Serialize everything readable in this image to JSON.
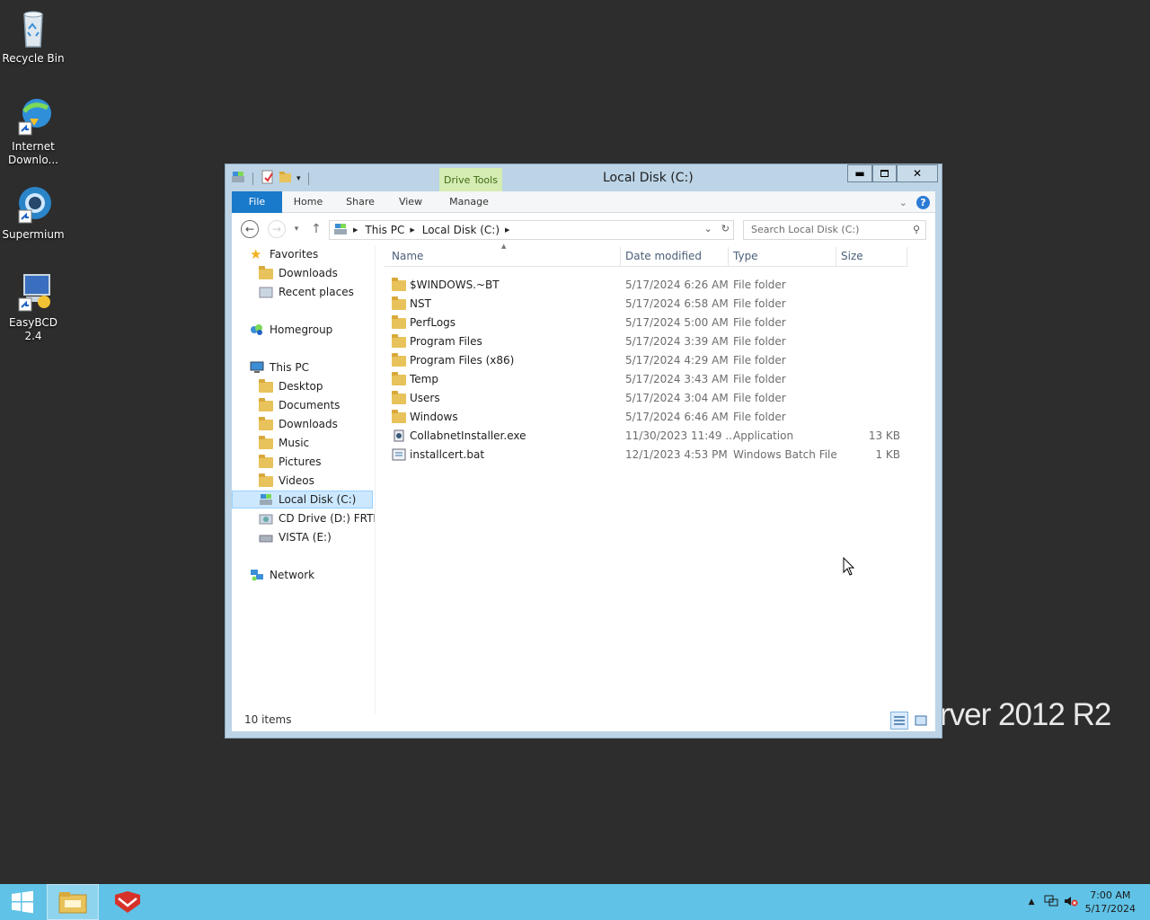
{
  "desktop": {
    "icons": [
      {
        "label": "Recycle Bin",
        "icon": "recycle-bin-icon"
      },
      {
        "label": "Internet Downlo...",
        "icon": "internet-download-manager-icon"
      },
      {
        "label": "Supermium",
        "icon": "supermium-icon"
      },
      {
        "label": "EasyBCD 2.4",
        "icon": "easybcd-icon"
      }
    ],
    "watermark": "rver 2012 R2"
  },
  "window": {
    "title": "Local Disk (C:)",
    "context_tab": "Drive Tools",
    "ribbon_tabs": [
      "File",
      "Home",
      "Share",
      "View",
      "Manage"
    ],
    "address": [
      "This PC",
      "Local Disk (C:)"
    ],
    "search_placeholder": "Search Local Disk (C:)",
    "nav": {
      "favorites": "Favorites",
      "fav_items": [
        "Downloads",
        "Recent places"
      ],
      "homegroup": "Homegroup",
      "thispc": "This PC",
      "pc_items": [
        "Desktop",
        "Documents",
        "Downloads",
        "Music",
        "Pictures",
        "Videos",
        "Local Disk (C:)",
        "CD Drive (D:) FRTMB",
        "VISTA (E:)"
      ],
      "network": "Network"
    },
    "columns": [
      "Name",
      "Date modified",
      "Type",
      "Size"
    ],
    "files": [
      {
        "name": "$WINDOWS.~BT",
        "date": "5/17/2024 6:26 AM",
        "type": "File folder",
        "size": "",
        "icon": "folder-icon"
      },
      {
        "name": "NST",
        "date": "5/17/2024 6:58 AM",
        "type": "File folder",
        "size": "",
        "icon": "folder-icon"
      },
      {
        "name": "PerfLogs",
        "date": "5/17/2024 5:00 AM",
        "type": "File folder",
        "size": "",
        "icon": "folder-icon"
      },
      {
        "name": "Program Files",
        "date": "5/17/2024 3:39 AM",
        "type": "File folder",
        "size": "",
        "icon": "folder-icon"
      },
      {
        "name": "Program Files (x86)",
        "date": "5/17/2024 4:29 AM",
        "type": "File folder",
        "size": "",
        "icon": "folder-icon"
      },
      {
        "name": "Temp",
        "date": "5/17/2024 3:43 AM",
        "type": "File folder",
        "size": "",
        "icon": "folder-icon"
      },
      {
        "name": "Users",
        "date": "5/17/2024 3:04 AM",
        "type": "File folder",
        "size": "",
        "icon": "folder-icon"
      },
      {
        "name": "Windows",
        "date": "5/17/2024 6:46 AM",
        "type": "File folder",
        "size": "",
        "icon": "folder-icon"
      },
      {
        "name": "CollabnetInstaller.exe",
        "date": "11/30/2023 11:49 ...",
        "type": "Application",
        "size": "13 KB",
        "icon": "exe-icon"
      },
      {
        "name": "installcert.bat",
        "date": "12/1/2023 4:53 PM",
        "type": "Windows Batch File",
        "size": "1 KB",
        "icon": "batch-file-icon"
      }
    ],
    "status": "10 items"
  },
  "taskbar": {
    "time": "7:00 AM",
    "date": "5/17/2024"
  }
}
